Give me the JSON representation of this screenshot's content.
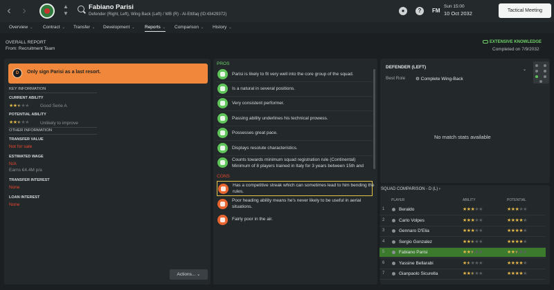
{
  "header": {
    "player_name": "Fabiano Parisi",
    "player_details": "Defender (Right, Left), Wing Back (Left) / WB (R) - Al-Ettifaq (ID:43429372)",
    "fm_logo": "FM",
    "time": "Sun 15:00",
    "date": "10 Oct 2032",
    "tactical_button": "Tactical Meeting"
  },
  "tabs": [
    {
      "label": "Overview"
    },
    {
      "label": "Contract"
    },
    {
      "label": "Transfer"
    },
    {
      "label": "Development"
    },
    {
      "label": "Reports"
    },
    {
      "label": "Comparison"
    },
    {
      "label": "History"
    }
  ],
  "report": {
    "title": "OVERALL REPORT",
    "from": "From: Recruitment Team",
    "knowledge": "EXTENSIVE KNOWLEDGE",
    "completed": "Completed on 7/9/2032",
    "banner_grade": "D",
    "banner_text": "Only sign Parisi as a last resort."
  },
  "key_info": {
    "heading": "KEY INFORMATION",
    "current_ability_label": "CURRENT ABILITY",
    "current_ability_text": "Good Serie A",
    "current_ability_stars": 2.5,
    "potential_ability_label": "POTENTIAL ABILITY",
    "potential_ability_text": "Unlikely to improve",
    "potential_ability_stars": 2.5,
    "other_heading": "OTHER INFORMATION",
    "transfer_value_label": "TRANSFER VALUE",
    "transfer_value": "Not for sale",
    "estimated_wage_label": "ESTIMATED WAGE",
    "estimated_wage": "N/A",
    "estimated_wage_sub": "Earns €4.4M p/a",
    "transfer_interest_label": "TRANSFER INTEREST",
    "transfer_interest": "None",
    "loan_interest_label": "LOAN INTEREST",
    "loan_interest": "None",
    "actions_button": "Actions..."
  },
  "pros_title": "PROS",
  "pros": [
    {
      "text": "Parisi is likely to fit very well into the core group of the squad."
    },
    {
      "text": "Is a natural in several positions."
    },
    {
      "text": "Very consistent performer."
    },
    {
      "text": "Passing ability underlines his technical prowess."
    },
    {
      "text": "Possesses great pace."
    },
    {
      "text": "Displays resolute characteristics."
    },
    {
      "text": "Counts towards minimum squad registration rule (Continental) Minimum of 8 players trained in Italy for 3 years between 15th and"
    }
  ],
  "cons_title": "CONS",
  "cons": [
    {
      "text": "Has a competitive streak which can sometimes lead to him bending the rules."
    },
    {
      "text": "Poor heading ability means he's never likely to be useful in aerial situations."
    },
    {
      "text": "Fairly poor in the air."
    }
  ],
  "position_panel": {
    "title": "DEFENDER (LEFT)",
    "best_role_label": "Best Role",
    "best_role": "Complete Wing-Back",
    "no_stats": "No match stats available"
  },
  "squad_comparison": {
    "title": "SQUAD COMPARISON - D (L)",
    "col_player": "PLAYER",
    "col_ability": "ABILITY",
    "col_potential": "POTENTIAL",
    "rows": [
      {
        "num": "1",
        "name": "Beraldo",
        "ability": 3,
        "potential": 3
      },
      {
        "num": "2",
        "name": "Carlo Volpes",
        "ability": 3,
        "potential": 4
      },
      {
        "num": "3",
        "name": "Gennaro D'Elia",
        "ability": 3,
        "potential": 4
      },
      {
        "num": "4",
        "name": "Sergio Gonzalez",
        "ability": 2.5,
        "potential": 4
      },
      {
        "num": "5",
        "name": "Fabiano Parisi",
        "ability": 2.5,
        "potential": 2.5
      },
      {
        "num": "6",
        "name": "Yassine Bellarabi",
        "ability": 1.5,
        "potential": 4
      },
      {
        "num": "7",
        "name": "Gianpaolo Sicurella",
        "ability": 2.5,
        "potential": 4
      }
    ]
  },
  "colors": {
    "accent_orange": "#f0873a",
    "pro_green": "#5fc45a",
    "con_red": "#e8492f",
    "star_gold": "#e6b84a",
    "highlight_row": "#3c7a2e"
  }
}
